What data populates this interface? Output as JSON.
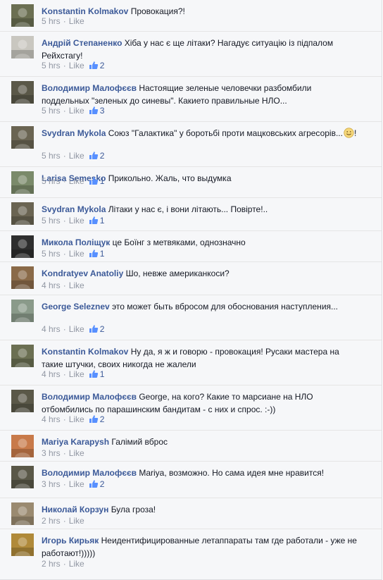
{
  "comments": [
    {
      "author": "Konstantin Kolmakov",
      "text": "Провокация?!",
      "time": "5 hrs",
      "like": "Like",
      "likes": "",
      "avatar": "avatar-konstantin",
      "color": "#6b6f52"
    },
    {
      "author": "Андрій Степаненко",
      "text": "Хіба у нас є ще літаки? Нагадує ситуацію із підпалом Рейхстагу!",
      "time": "5 hrs",
      "like": "Like",
      "likes": "2",
      "avatar": "avatar-andriy",
      "color": "#c9c7c0"
    },
    {
      "author": "Володимир Малофєєв",
      "text": "Настоящие зеленые человечки разбомбили поддельных \"зеленых до синевы\". Какието правильные НЛО...",
      "time": "5 hrs",
      "like": "Like",
      "likes": "3",
      "avatar": "avatar-volodymyr",
      "color": "#5a5848"
    },
    {
      "author": "Svydran Mykola",
      "text": "Союз \"Галактика\" у боротьбі проти мацковських агресорів...",
      "time": "5 hrs",
      "like": "Like",
      "likes": "2",
      "avatar": "avatar-svydran",
      "color": "#6a6452",
      "emoji": "smile-emoji-icon"
    },
    {
      "author": "Larisa Semesko",
      "text": "Прикольно. Жаль, что выдумка",
      "time": "5 hrs",
      "like": "Like",
      "likes": "1",
      "avatar": "avatar-larisa",
      "color": "#7a8a6a"
    },
    {
      "author": "Svydran Mykola",
      "text": "Літаки у нас є, і вони літають... Повірте!..",
      "time": "5 hrs",
      "like": "Like",
      "likes": "1",
      "avatar": "avatar-svydran",
      "color": "#6a6452"
    },
    {
      "author": "Микола Поліщук",
      "text": "це Боїнг з метвяками, однозначно",
      "time": "5 hrs",
      "like": "Like",
      "likes": "1",
      "avatar": "avatar-mykola",
      "color": "#2e2e2e"
    },
    {
      "author": "Kondratyev Anatoliy",
      "text": "Шо, невже американкоси?",
      "time": "4 hrs",
      "like": "Like",
      "likes": "",
      "avatar": "avatar-kondratyev",
      "color": "#8a6a48"
    },
    {
      "author": "George Seleznev",
      "text": "это может быть вбросом для обоснования наступления...",
      "time": "4 hrs",
      "like": "Like",
      "likes": "2",
      "avatar": "avatar-george",
      "color": "#8a9a8a"
    },
    {
      "author": "Konstantin Kolmakov",
      "text": "Ну да, я ж и говорю - провокация! Русаки мастера на такие штучки, своих никогда не жалели",
      "time": "4 hrs",
      "like": "Like",
      "likes": "1",
      "avatar": "avatar-konstantin",
      "color": "#6b6f52"
    },
    {
      "author": "Володимир Малофєєв",
      "text": "George, на кого? Какие то марсиане на НЛО отбомбились по парашинским бандитам - с них и спрос. :-))",
      "time": "4 hrs",
      "like": "Like",
      "likes": "2",
      "avatar": "avatar-volodymyr",
      "color": "#5a5848"
    },
    {
      "author": "Mariya Karapysh",
      "text": "Галімий вброс",
      "time": "3 hrs",
      "like": "Like",
      "likes": "",
      "avatar": "avatar-mariya",
      "color": "#c87a4a"
    },
    {
      "author": "Володимир Малофєєв",
      "text": "Mariya, возможно. Но сама идея мне нравится!",
      "time": "3 hrs",
      "like": "Like",
      "likes": "2",
      "avatar": "avatar-volodymyr",
      "color": "#5a5848"
    },
    {
      "author": "Николай Корзун",
      "text": "Була гроза!",
      "time": "2 hrs",
      "like": "Like",
      "likes": "",
      "avatar": "avatar-nikolay",
      "color": "#9a8a70"
    },
    {
      "author": "Игорь Кирьяк",
      "text": "Неидентифицированные летаппараты там где работали - уже не работают!)))))",
      "time": "2 hrs",
      "like": "Like",
      "likes": "",
      "avatar": "avatar-igor",
      "color": "#b08a3a"
    }
  ],
  "separator": "·"
}
